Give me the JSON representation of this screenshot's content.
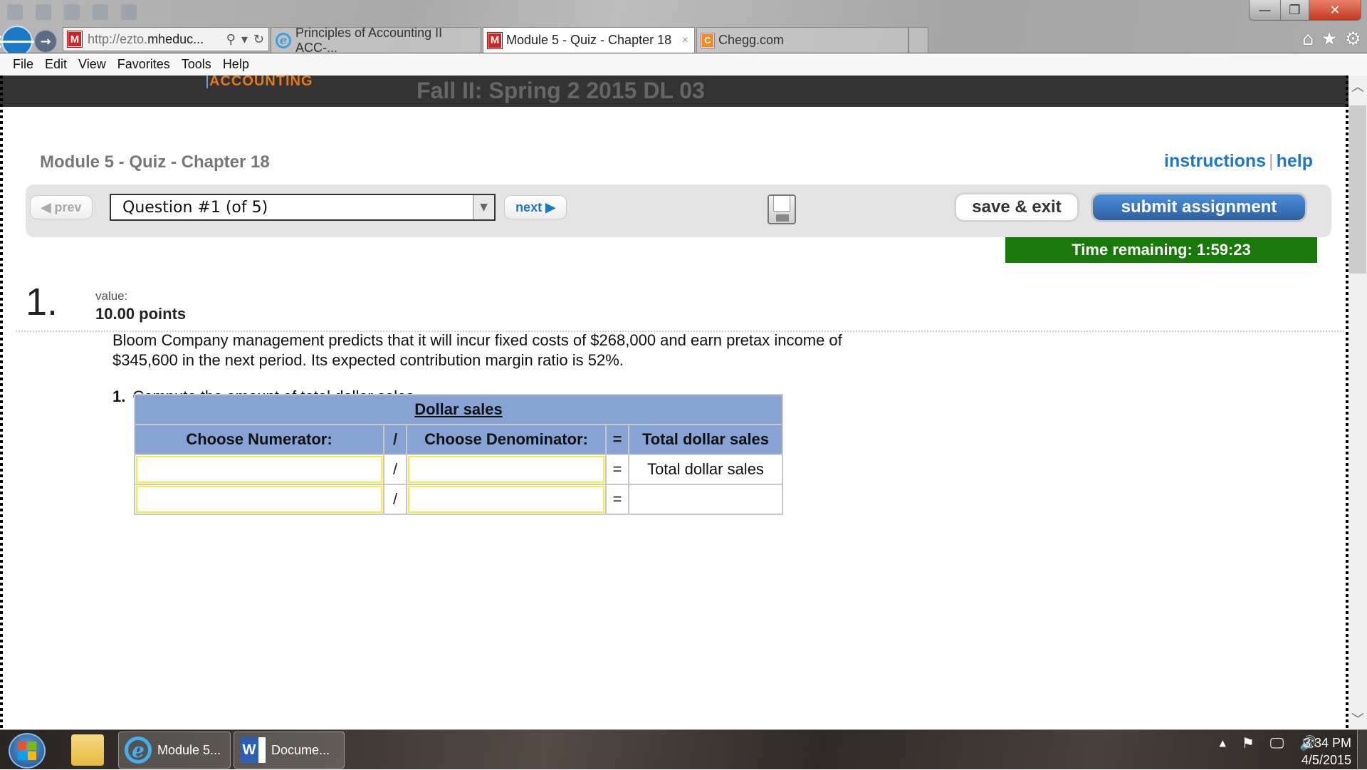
{
  "browser": {
    "window_controls": {
      "minimize": "—",
      "restore": "❐",
      "close": "✕"
    },
    "back_icon": "🡐",
    "forward_icon": "→",
    "address": {
      "scheme_prefix": "http://ezto.",
      "host": "mheduc...",
      "search_icon": "⚲",
      "dropdown_icon": "▾",
      "refresh_icon": "↻",
      "favicon": "M"
    },
    "tabs": [
      {
        "label": "Principles of Accounting II ACC-...",
        "favicon": "e",
        "active": false
      },
      {
        "label": "Module 5 - Quiz - Chapter 18",
        "favicon": "M",
        "active": true,
        "close": "×"
      },
      {
        "label": "Chegg.com",
        "favicon": "C",
        "active": false
      }
    ],
    "right_icons": {
      "home": "⌂",
      "favorites": "★",
      "tools": "⚙"
    },
    "menu": [
      "File",
      "Edit",
      "View",
      "Favorites",
      "Tools",
      "Help"
    ]
  },
  "site": {
    "brand": "ACCOUNTING",
    "course": "Fall II: Spring 2 2015 DL 03"
  },
  "quiz": {
    "title": "Module 5 - Quiz - Chapter 18",
    "links": {
      "instructions": "instructions",
      "separator": "|",
      "help": "help"
    },
    "toolbar": {
      "prev": "◀ prev",
      "question_selector": "Question #1 (of 5)",
      "dropdown_icon": "▼",
      "next": "next ▶",
      "save_exit": "save & exit",
      "submit": "submit assignment"
    },
    "timer": "Time remaining: 1:59:23",
    "colors": {
      "timer_bg": "#187a08",
      "submit_bg": "#2e5f9e",
      "link": "#1a7ac8",
      "table_header": "#87a3d4",
      "input_border": "#f3ef3a"
    }
  },
  "question": {
    "number": "1.",
    "value_label": "value:",
    "points": "10.00 points",
    "text": "Bloom Company management predicts that it will incur fixed costs of $268,000 and earn pretax income of $345,600 in the next period. Its expected contribution margin ratio is 52%.",
    "task_number": "1.",
    "task": "Compute the amount of total dollar sales.",
    "table": {
      "title": "Dollar sales",
      "headers": [
        "Choose Numerator:",
        "/",
        "Choose Denominator:",
        "=",
        "Total dollar sales"
      ],
      "rows": [
        {
          "numerator": "",
          "divide": "/",
          "denominator": "",
          "equals": "=",
          "result": "Total dollar sales"
        },
        {
          "numerator": "",
          "divide": "/",
          "denominator": "",
          "equals": "=",
          "result": ""
        }
      ]
    }
  },
  "scrollbar": {
    "up": "︿",
    "down": "﹀",
    "position": 0.0
  },
  "taskbar": {
    "buttons": [
      {
        "label": "Module 5...",
        "icon": "e"
      },
      {
        "label": "Docume...",
        "icon": "W"
      }
    ],
    "tray": {
      "expand": "▲",
      "flag": "⚑",
      "network": "🖵",
      "volume": "🔊"
    },
    "clock": {
      "time": "3:34 PM",
      "date": "4/5/2015"
    }
  }
}
